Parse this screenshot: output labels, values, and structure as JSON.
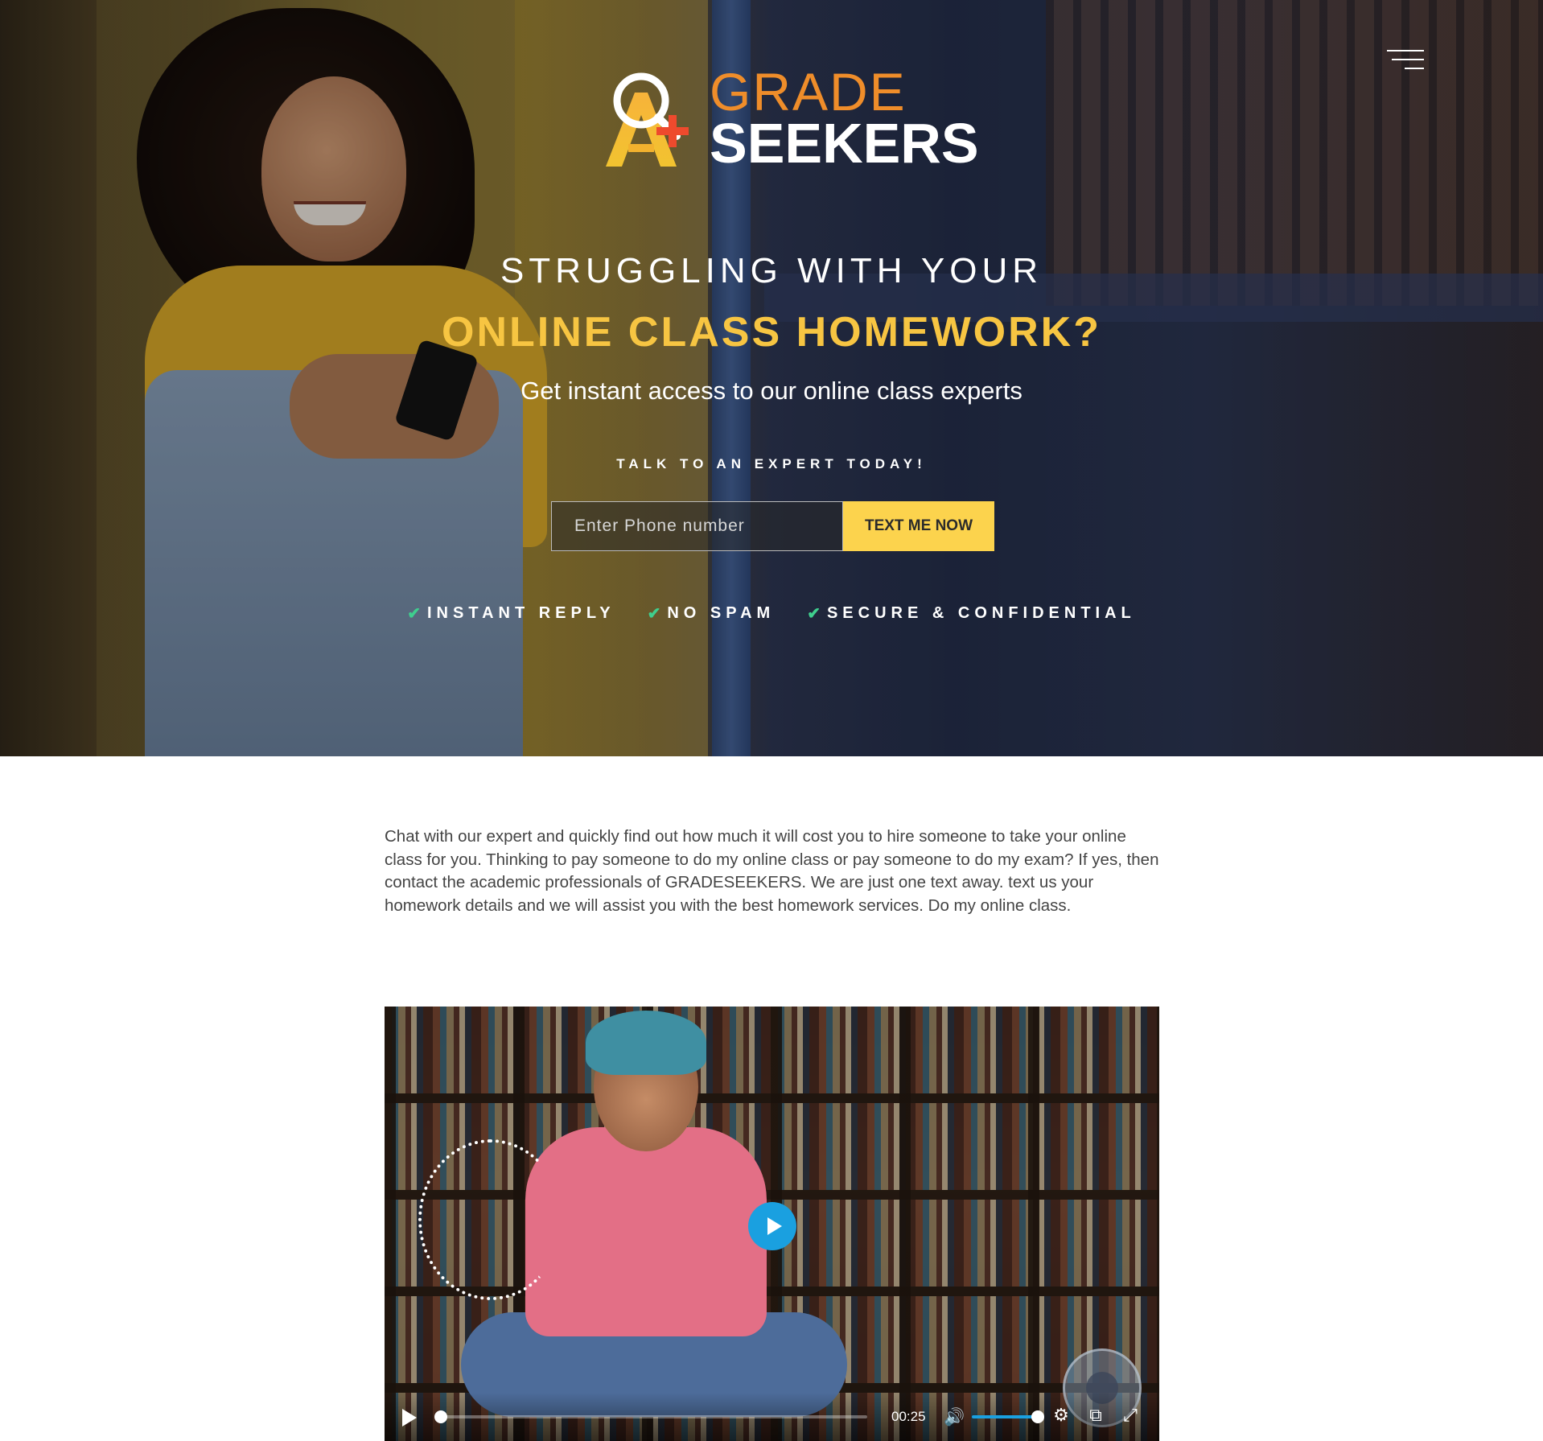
{
  "brand": {
    "grade": "GRADE",
    "seekers": "SEEKERS",
    "mark_letters": "A+",
    "accent_color": "#ef8d2a",
    "highlight_color": "#f7c542"
  },
  "hero": {
    "subheading": "STRUGGLING WITH YOUR",
    "heading": "ONLINE CLASS HOMEWORK?",
    "description": "Get instant access to our online class experts",
    "talk_label": "TALK TO AN EXPERT TODAY!",
    "phone_placeholder": "Enter Phone number",
    "button_label": "TEXT ME NOW",
    "button_color": "#fcd34d",
    "badges": [
      {
        "icon": "check-icon",
        "label": "INSTANT REPLY"
      },
      {
        "icon": "check-icon",
        "label": "NO SPAM"
      },
      {
        "icon": "check-icon",
        "label": "SECURE & CONFIDENTIAL"
      }
    ],
    "check_color": "#3fcf8e"
  },
  "intro": {
    "text": "Chat with our expert and quickly find out how much it will cost you to hire someone to take your online class for you. Thinking to pay someone to do my online class or pay someone to do my exam? If yes, then contact the academic professionals of GRADESEEKERS. We are just one text away. text us your homework details and we will assist you with the best homework services. Do my online class."
  },
  "video": {
    "time": "00:25",
    "progress": 0.0,
    "volume": 1.0,
    "play_color": "#1aa0e0",
    "icons": [
      "play-icon",
      "volume-icon",
      "settings-icon",
      "popout-icon",
      "fullscreen-icon"
    ]
  }
}
